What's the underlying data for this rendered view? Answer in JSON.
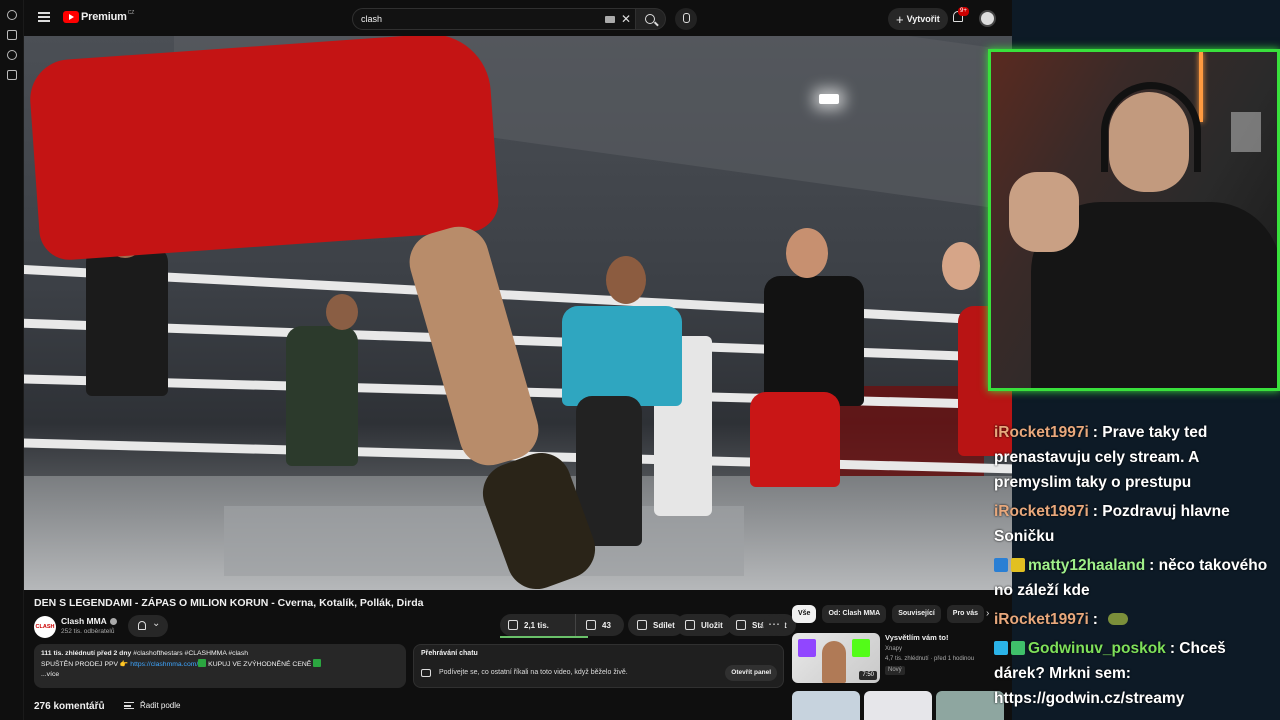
{
  "topbar": {
    "brand": "Premium",
    "brand_country": "CZ",
    "search_value": "clash",
    "create_label": "Vytvořit",
    "notif_count": "9+"
  },
  "video": {
    "title": "DEN S LEGENDAMI - ZÁPAS O MILION KORUN - Cverna, Kotalík, Pollák, Dirda",
    "channel": "Clash MMA",
    "channel_logo": "CLASH",
    "subscribers": "252 tis. odběratelů",
    "likes": "2,1 tis.",
    "dislikes": "43",
    "share": "Sdílet",
    "save": "Uložit",
    "download": "Stáhnout",
    "like_ratio": 0.98
  },
  "description": {
    "meta": "111 tis. zhlédnutí  před 2 dny",
    "tags": " #clashofthestars #CLASHMMA #clash",
    "line2_pre": "SPUŠTĚN PRODEJ PPV 👉 ",
    "link": "https://clashmma.com/",
    "line2_post": " KUPUJ VE ZVÝHODNĚNÉ CENĚ ",
    "more": "...více"
  },
  "chat_replay": {
    "heading": "Přehrávání chatu",
    "body": "Podívejte se, co ostatní říkali na toto video, když běželo živě.",
    "button": "Otevřít panel"
  },
  "comments": {
    "count": "276 komentářů",
    "sort": "Řadit podle"
  },
  "chips": [
    "Vše",
    "Od: Clash MMA",
    "Související",
    "Pro vás"
  ],
  "recommendation": {
    "title": "Vysvětlím vám to!",
    "channel": "Xnapy",
    "views": "4,7 tis. zhlédnutí · před 1 hodinou",
    "badge": "Nový",
    "duration": "7:50"
  },
  "stream_chat": [
    {
      "user": "iRocket1997i",
      "color": "#e8a87c",
      "text": "Prave taky ted prenastavuju cely stream. A premyslim taky o prestupu"
    },
    {
      "user": "iRocket1997i",
      "color": "#e8a87c",
      "text": "Pozdravuj hlavne Soničku"
    },
    {
      "user": "matty12haaland",
      "color": "#9ff08a",
      "text": "něco takového no záleží kde"
    },
    {
      "user": "iRocket1997i",
      "color": "#e8a87c",
      "text": ""
    },
    {
      "user": "Godwinuv_poskok",
      "color": "#7ee05a",
      "text": "Chceš dárek? Mrkni sem: https://godwin.cz/streamy"
    }
  ],
  "colors": {
    "accent_red": "#ff0000",
    "cam_border": "#39e03c",
    "link": "#3ea6ff"
  }
}
